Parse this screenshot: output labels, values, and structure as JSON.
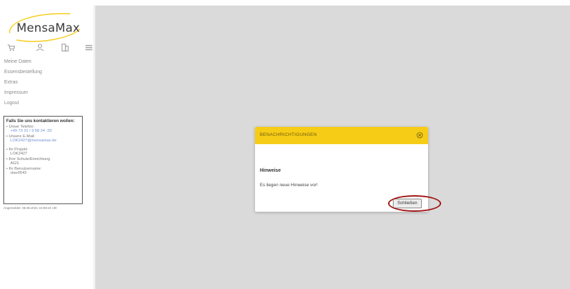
{
  "sidebar": {
    "logo_text": "MensaMax",
    "icons": [
      "cart-icon",
      "person-icon",
      "building-icon",
      "menu-icon"
    ],
    "nav": {
      "items": [
        "Meine Daten",
        "Essensbestellung",
        "Extras",
        "Impressum",
        "Logout"
      ]
    },
    "contact": {
      "heading": "Falls Sie uns kontaktieren wollen:",
      "phone_label": "• Unser Telefon:",
      "phone_value": "+49 73 31 / 9 58 24 -20",
      "email_label": "• Unsere E-Mail:",
      "email_value": "LOK2427@mensamax.de",
      "project_label": "• Ihr Projekt:",
      "project_value": "LOK2427",
      "school_label": "• Ihre Schule/Einrichtung",
      "school_value": "AGS",
      "user_label": "• Ihr Benutzername:",
      "user_value": "stav0543"
    },
    "logged_in": "Angemeldet: 06.08.2021 15:08:22 Uhr"
  },
  "dialog": {
    "title": "BENACHRICHTIGUNGEN",
    "heading": "Hinweise",
    "message": "Es liegen neue Hinweise vor!",
    "close_button": "Schließen"
  },
  "colors": {
    "header": "#f7cc16",
    "highlight": "#a01212",
    "background": "#dadada"
  }
}
